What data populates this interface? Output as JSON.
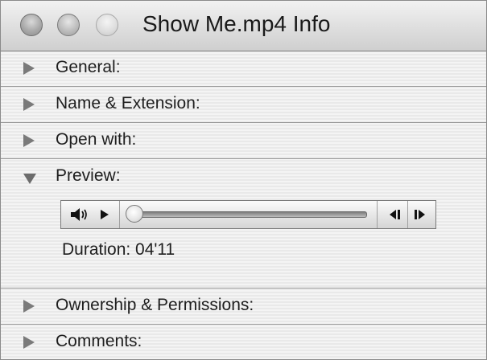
{
  "window": {
    "title": "Show Me.mp4 Info"
  },
  "sections": [
    {
      "label": "General:",
      "expanded": false
    },
    {
      "label": "Name & Extension:",
      "expanded": false
    },
    {
      "label": "Open with:",
      "expanded": false
    },
    {
      "label": "Preview:",
      "expanded": true
    },
    {
      "label": "Ownership & Permissions:",
      "expanded": false
    },
    {
      "label": "Comments:",
      "expanded": false
    }
  ],
  "preview": {
    "duration_text": "Duration: 04'11",
    "playback_position": 0.0,
    "controls": [
      "volume-icon",
      "play-icon",
      "step-back-icon",
      "step-forward-icon"
    ]
  }
}
